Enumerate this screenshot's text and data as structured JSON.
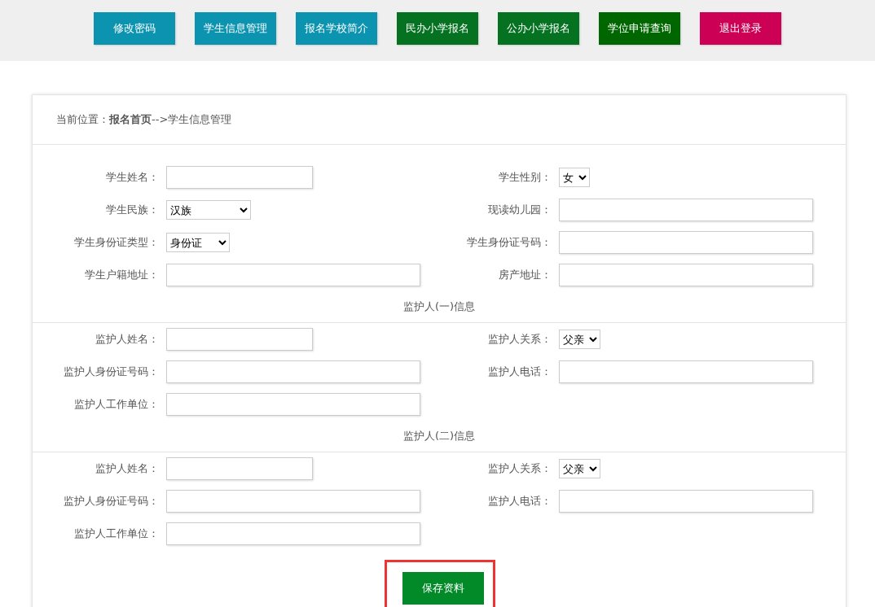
{
  "nav_buttons": [
    {
      "label": "修改密码",
      "color": "#0b93b0"
    },
    {
      "label": "学生信息管理",
      "color": "#0b93b0"
    },
    {
      "label": "报名学校简介",
      "color": "#0b93b0"
    },
    {
      "label": "民办小学报名",
      "color": "#047220"
    },
    {
      "label": "公办小学报名",
      "color": "#047220"
    },
    {
      "label": "学位申请查询",
      "color": "#006600"
    },
    {
      "label": "退出登录",
      "color": "#cc0055"
    }
  ],
  "breadcrumb": "当前位置：**报名首页**-->学生信息管理",
  "sections": [
    {
      "fields": [
        {
          "label": "学生姓名：",
          "kind": "text"
        },
        {
          "label": "学生性别：",
          "kind": "select",
          "value": "女"
        },
        {
          "label": "学生民族：",
          "kind": "select",
          "value": "汉族"
        },
        {
          "label": "现读幼儿园：",
          "kind": "text"
        },
        {
          "label": "学生身份证类型：",
          "kind": "select",
          "value": "身份证"
        },
        {
          "label": "学生身份证号码：",
          "kind": "text"
        },
        {
          "label": "学生户籍地址：",
          "kind": "text"
        },
        {
          "label": "房产地址：",
          "kind": "text"
        }
      ]
    },
    {
      "title": "监护人(一)信息",
      "fields": [
        {
          "label": "监护人姓名：",
          "kind": "text"
        },
        {
          "label": "监护人关系：",
          "kind": "select",
          "value": "父亲"
        },
        {
          "label": "监护人身份证号码：",
          "kind": "text"
        },
        {
          "label": "监护人电话：",
          "kind": "text"
        },
        {
          "label": "监护人工作单位：",
          "kind": "text"
        }
      ]
    },
    {
      "title": "监护人(二)信息",
      "fields": [
        {
          "label": "监护人姓名：",
          "kind": "text"
        },
        {
          "label": "监护人关系：",
          "kind": "select",
          "value": "父亲"
        },
        {
          "label": "监护人身份证号码：",
          "kind": "text"
        },
        {
          "label": "监护人电话：",
          "kind": "text"
        },
        {
          "label": "监护人工作单位：",
          "kind": "text"
        }
      ]
    }
  ],
  "save_button": "保存资料"
}
